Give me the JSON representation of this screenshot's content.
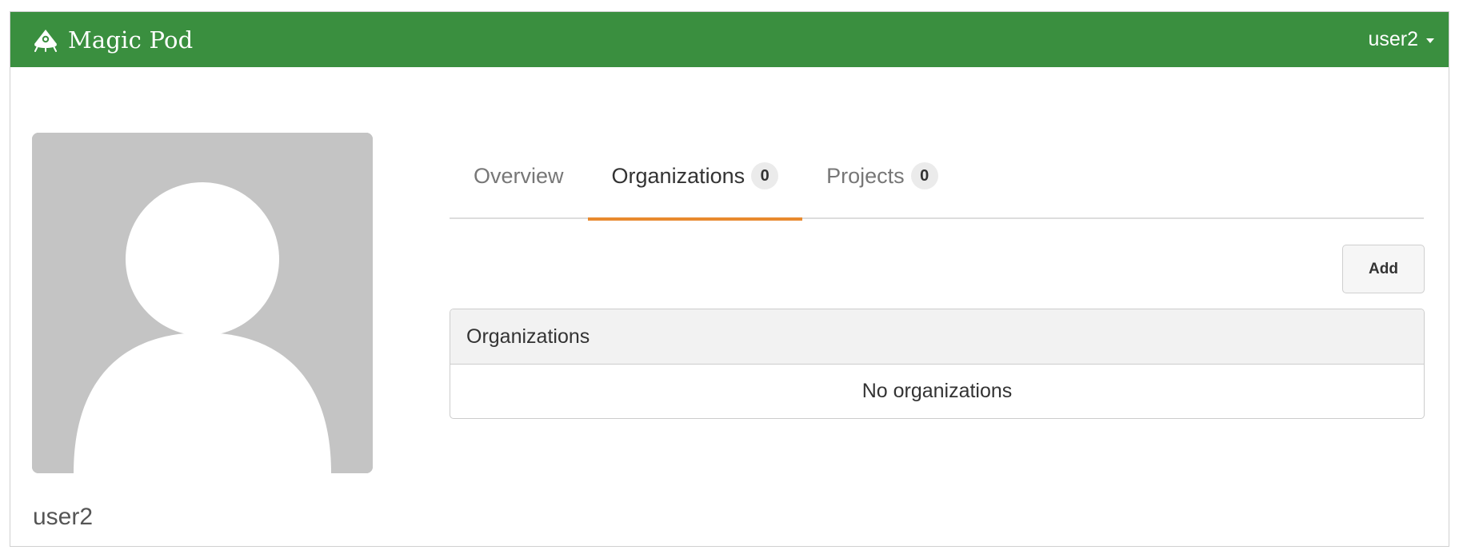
{
  "navbar": {
    "brand_name": "Magic Pod",
    "brand_icon": "magic-pod-logo-icon",
    "user_menu_label": "user2",
    "background_color": "#3a8f3f"
  },
  "profile": {
    "avatar_icon": "default-user-avatar",
    "username": "user2"
  },
  "tabs": [
    {
      "label": "Overview",
      "count": null,
      "active": false
    },
    {
      "label": "Organizations",
      "count": "0",
      "active": true
    },
    {
      "label": "Projects",
      "count": "0",
      "active": false
    }
  ],
  "active_tab_color": "#e8892e",
  "actions": {
    "add_label": "Add"
  },
  "organizations_panel": {
    "heading": "Organizations",
    "empty_message": "No organizations"
  }
}
